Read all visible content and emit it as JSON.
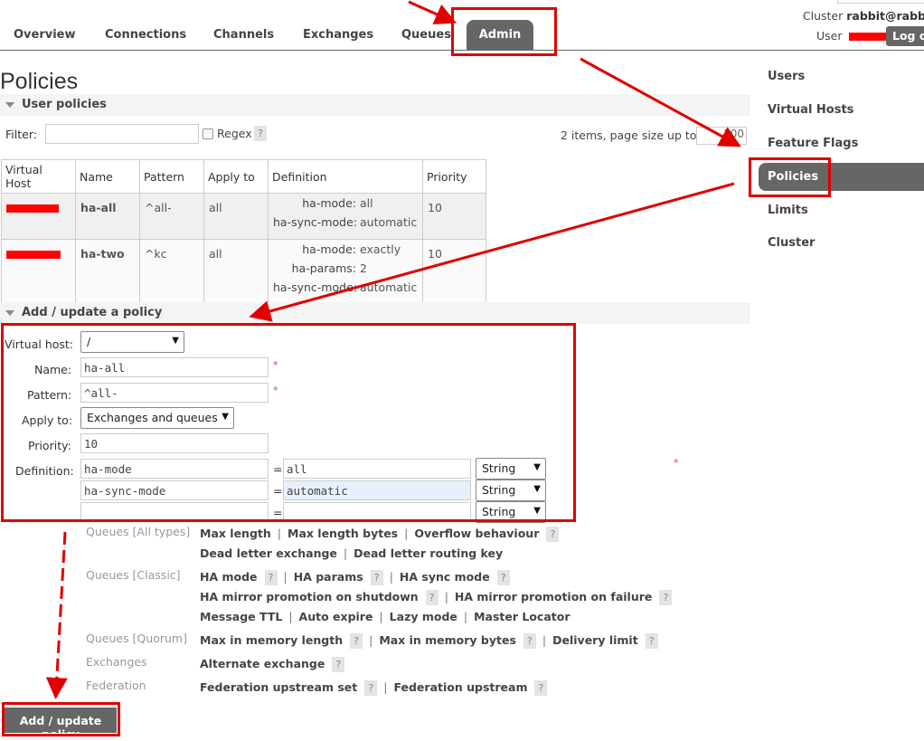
{
  "nav": {
    "tabs": [
      "Overview",
      "Connections",
      "Channels",
      "Exchanges",
      "Queues"
    ],
    "active_tab": "Admin",
    "cluster_label": "Cluster",
    "cluster_name": "rabbit@rabb",
    "user_label": "User",
    "logout_label": "Log o"
  },
  "page_title": "Policies",
  "user_policies": {
    "section_label": "User policies",
    "filter_label": "Filter:",
    "regex_label": "Regex",
    "help_glyph": "?",
    "pager_text": "2 items, page size up to",
    "page_size": "100",
    "columns": [
      "Virtual Host",
      "Name",
      "Pattern",
      "Apply to",
      "Definition",
      "Priority"
    ],
    "rows": [
      {
        "name": "ha-all",
        "pattern": "^all-",
        "apply_to": "all",
        "definition": [
          {
            "key": "ha-mode:",
            "value": "all"
          },
          {
            "key": "ha-sync-mode:",
            "value": "automatic"
          }
        ],
        "priority": "10"
      },
      {
        "name": "ha-two",
        "pattern": "^kc",
        "apply_to": "all",
        "definition": [
          {
            "key": "ha-mode:",
            "value": "exactly"
          },
          {
            "key": "ha-params:",
            "value": "2"
          },
          {
            "key": "ha-sync-mode:",
            "value": "automatic"
          }
        ],
        "priority": "10"
      }
    ]
  },
  "add_policy": {
    "section_label": "Add / update a policy",
    "virtual_host_label": "Virtual host:",
    "virtual_host_value": "/",
    "name_label": "Name:",
    "name_value": "ha-all",
    "pattern_label": "Pattern:",
    "pattern_value": "^all-",
    "apply_to_label": "Apply to:",
    "apply_to_value": "Exchanges and queues",
    "priority_label": "Priority:",
    "priority_value": "10",
    "definition_label": "Definition:",
    "required_mark": "*",
    "equals": "=",
    "definition_rows": [
      {
        "key": "ha-mode",
        "value": "all",
        "type": "String"
      },
      {
        "key": "ha-sync-mode",
        "value": "automatic",
        "type": "String"
      },
      {
        "key": "",
        "value": "",
        "type": "String"
      }
    ],
    "option_groups": [
      {
        "category": "Queues [All types]",
        "lines": [
          [
            {
              "label": "Max length"
            },
            {
              "label": "Max length bytes"
            },
            {
              "label": "Overflow behaviour",
              "help": true
            }
          ],
          [
            {
              "label": "Dead letter exchange"
            },
            {
              "label": "Dead letter routing key"
            }
          ]
        ]
      },
      {
        "category": "Queues [Classic]",
        "lines": [
          [
            {
              "label": "HA mode",
              "help": true
            },
            {
              "label": "HA params",
              "help": true
            },
            {
              "label": "HA sync mode",
              "help": true
            }
          ],
          [
            {
              "label": "HA mirror promotion on shutdown",
              "help": true
            },
            {
              "label": "HA mirror promotion on failure",
              "help": true
            }
          ],
          [
            {
              "label": "Message TTL"
            },
            {
              "label": "Auto expire"
            },
            {
              "label": "Lazy mode"
            },
            {
              "label": "Master Locator"
            }
          ]
        ]
      },
      {
        "category": "Queues [Quorum]",
        "lines": [
          [
            {
              "label": "Max in memory length",
              "help": true
            },
            {
              "label": "Max in memory bytes",
              "help": true
            },
            {
              "label": "Delivery limit",
              "help": true
            }
          ]
        ]
      },
      {
        "category": "Exchanges",
        "lines": [
          [
            {
              "label": "Alternate exchange",
              "help": true
            }
          ]
        ]
      },
      {
        "category": "Federation",
        "lines": [
          [
            {
              "label": "Federation upstream set",
              "help": true
            },
            {
              "label": "Federation upstream",
              "help": true
            }
          ]
        ]
      }
    ],
    "submit_label": "Add / update policy"
  },
  "sidebar": {
    "items": [
      "Users",
      "Virtual Hosts",
      "Feature Flags",
      "Policies",
      "Limits",
      "Cluster"
    ],
    "active": "Policies"
  },
  "colors": {
    "annotation_red": "#e00000",
    "active_tab_bg": "#666666",
    "section_bg": "#f4f4f4"
  }
}
